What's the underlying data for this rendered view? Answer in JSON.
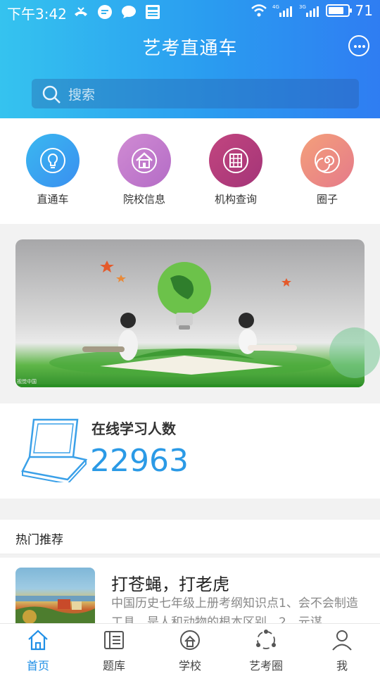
{
  "status_bar": {
    "time": "下午3:42",
    "battery": "71",
    "net1": "4G",
    "net2": "3G"
  },
  "header": {
    "title": "艺考直通车",
    "message_icon": "chat-bubble-icon"
  },
  "search": {
    "placeholder": "搜索"
  },
  "quick_links": [
    {
      "label": "直通车",
      "icon": "lightbulb-icon",
      "color": "#3fa6ee"
    },
    {
      "label": "院校信息",
      "icon": "school-icon",
      "color": "#c57acb"
    },
    {
      "label": "机构查询",
      "icon": "building-grid-icon",
      "color": "#b03b7c"
    },
    {
      "label": "圈子",
      "icon": "spiral-icon",
      "color": "#ee8a7a"
    }
  ],
  "banner": {
    "caption": "视觉中国"
  },
  "online": {
    "label": "在线学习人数",
    "count": "22963"
  },
  "hot": {
    "heading": "热门推荐",
    "articles": [
      {
        "title": "打苍蝇，打老虎",
        "summary": "中国历史七年级上册考纲知识点1、会不会制造工具，是人和动物的根本区别。2、元谋"
      }
    ]
  },
  "tabs": [
    {
      "label": "首页",
      "icon": "home-icon",
      "active": true
    },
    {
      "label": "题库",
      "icon": "question-bank-icon",
      "active": false
    },
    {
      "label": "学校",
      "icon": "school-pin-icon",
      "active": false
    },
    {
      "label": "艺考圈",
      "icon": "circle-network-icon",
      "active": false
    },
    {
      "label": "我",
      "icon": "user-icon",
      "active": false
    }
  ],
  "colors": {
    "accent": "#2b9ae6",
    "header_start": "#35c3ef",
    "header_end": "#2f7df2"
  }
}
